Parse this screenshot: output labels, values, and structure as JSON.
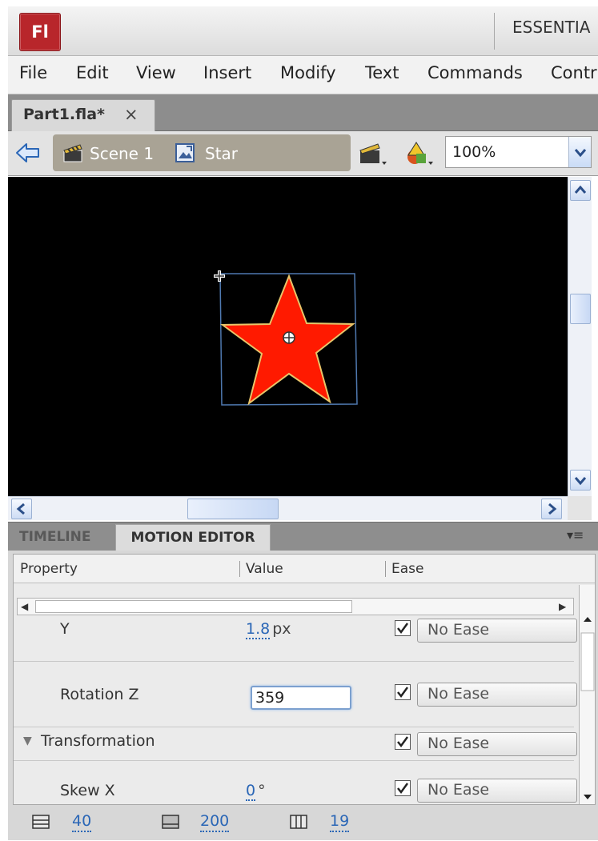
{
  "app": {
    "logo_text": "Fl",
    "workspace": "ESSENTIA"
  },
  "menu": {
    "items": [
      "File",
      "Edit",
      "View",
      "Insert",
      "Modify",
      "Text",
      "Commands",
      "Contr"
    ]
  },
  "document_tab": {
    "label": "Part1.fla*",
    "close": "×"
  },
  "edit_bar": {
    "scene_label": "Scene 1",
    "symbol_label": "Star",
    "zoom": "100%"
  },
  "stage": {
    "background": "#000000",
    "star_fill": "#ff1a00",
    "star_stroke": "#e8c56a",
    "bounding_box": "#4f79b0"
  },
  "panel_tabs": {
    "timeline": "TIMELINE",
    "motion_editor": "MOTION EDITOR",
    "menu_glyph": "▾≡"
  },
  "motion_editor": {
    "columns": {
      "property": "Property",
      "value": "Value",
      "ease": "Ease"
    },
    "rows": [
      {
        "name": "Y",
        "value": "1.8",
        "unit": "px",
        "ease": "No Ease"
      },
      {
        "name": "Rotation Z",
        "input_value": "359",
        "ease": "No Ease"
      },
      {
        "group": "Transformation",
        "ease": "No Ease"
      },
      {
        "name": "Skew X",
        "value": "0",
        "unit": "°",
        "ease": "No Ease"
      }
    ],
    "footer": {
      "graph_size": "40",
      "expanded_graph_size": "200",
      "viewable_frames": "19"
    }
  },
  "colors": {
    "link_blue": "#2a66b6",
    "flash_red": "#b8262b"
  }
}
